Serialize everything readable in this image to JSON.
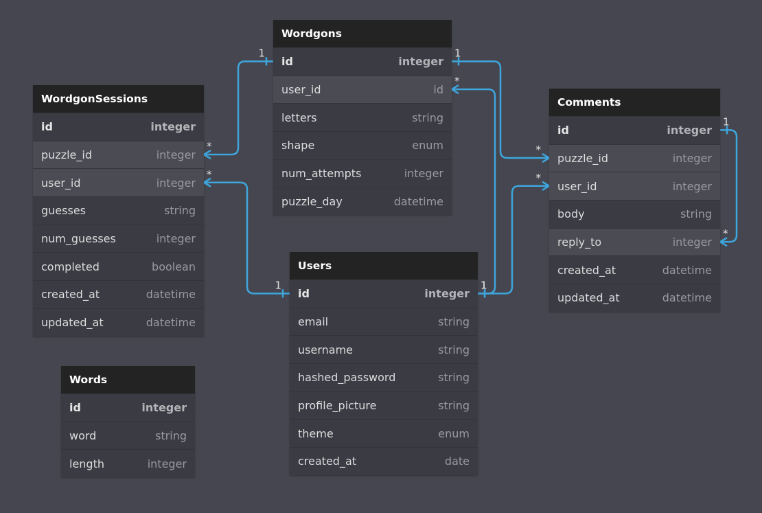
{
  "colors": {
    "background": "#45464f",
    "header": "#232323",
    "row": "#3a3b43",
    "fk_row": "#4a4b53",
    "edge": "#3ea6dd"
  },
  "tables": [
    {
      "name": "Wordgons",
      "fields": [
        {
          "name": "id",
          "type": "integer",
          "pk": true
        },
        {
          "name": "user_id",
          "type": "id",
          "fk": true
        },
        {
          "name": "letters",
          "type": "string"
        },
        {
          "name": "shape",
          "type": "enum"
        },
        {
          "name": "num_attempts",
          "type": "integer"
        },
        {
          "name": "puzzle_day",
          "type": "datetime"
        }
      ]
    },
    {
      "name": "WordgonSessions",
      "fields": [
        {
          "name": "id",
          "type": "integer",
          "pk": true
        },
        {
          "name": "puzzle_id",
          "type": "integer",
          "fk": true
        },
        {
          "name": "user_id",
          "type": "integer",
          "fk": true
        },
        {
          "name": "guesses",
          "type": "string"
        },
        {
          "name": "num_guesses",
          "type": "integer"
        },
        {
          "name": "completed",
          "type": "boolean"
        },
        {
          "name": "created_at",
          "type": "datetime"
        },
        {
          "name": "updated_at",
          "type": "datetime"
        }
      ]
    },
    {
      "name": "Comments",
      "fields": [
        {
          "name": "id",
          "type": "integer",
          "pk": true
        },
        {
          "name": "puzzle_id",
          "type": "integer",
          "fk": true
        },
        {
          "name": "user_id",
          "type": "integer",
          "fk": true
        },
        {
          "name": "body",
          "type": "string"
        },
        {
          "name": "reply_to",
          "type": "integer",
          "fk": true
        },
        {
          "name": "created_at",
          "type": "datetime"
        },
        {
          "name": "updated_at",
          "type": "datetime"
        }
      ]
    },
    {
      "name": "Users",
      "fields": [
        {
          "name": "id",
          "type": "integer",
          "pk": true
        },
        {
          "name": "email",
          "type": "string"
        },
        {
          "name": "username",
          "type": "string"
        },
        {
          "name": "hashed_password",
          "type": "string"
        },
        {
          "name": "profile_picture",
          "type": "string"
        },
        {
          "name": "theme",
          "type": "enum"
        },
        {
          "name": "created_at",
          "type": "date"
        }
      ]
    },
    {
      "name": "Words",
      "fields": [
        {
          "name": "id",
          "type": "integer",
          "pk": true
        },
        {
          "name": "word",
          "type": "string"
        },
        {
          "name": "length",
          "type": "integer"
        }
      ]
    }
  ],
  "relations": [
    {
      "from": "WordgonSessions.puzzle_id",
      "from_card": "*",
      "to": "Wordgons.id",
      "to_card": "1"
    },
    {
      "from": "Comments.puzzle_id",
      "from_card": "*",
      "to": "Wordgons.id",
      "to_card": "1"
    },
    {
      "from": "Wordgons.user_id",
      "from_card": "*",
      "to": "Users.id",
      "to_card": "1"
    },
    {
      "from": "WordgonSessions.user_id",
      "from_card": "*",
      "to": "Users.id",
      "to_card": "1"
    },
    {
      "from": "Comments.user_id",
      "from_card": "*",
      "to": "Users.id",
      "to_card": "1"
    },
    {
      "from": "Comments.reply_to",
      "from_card": "*",
      "to": "Comments.id",
      "to_card": "1"
    }
  ]
}
